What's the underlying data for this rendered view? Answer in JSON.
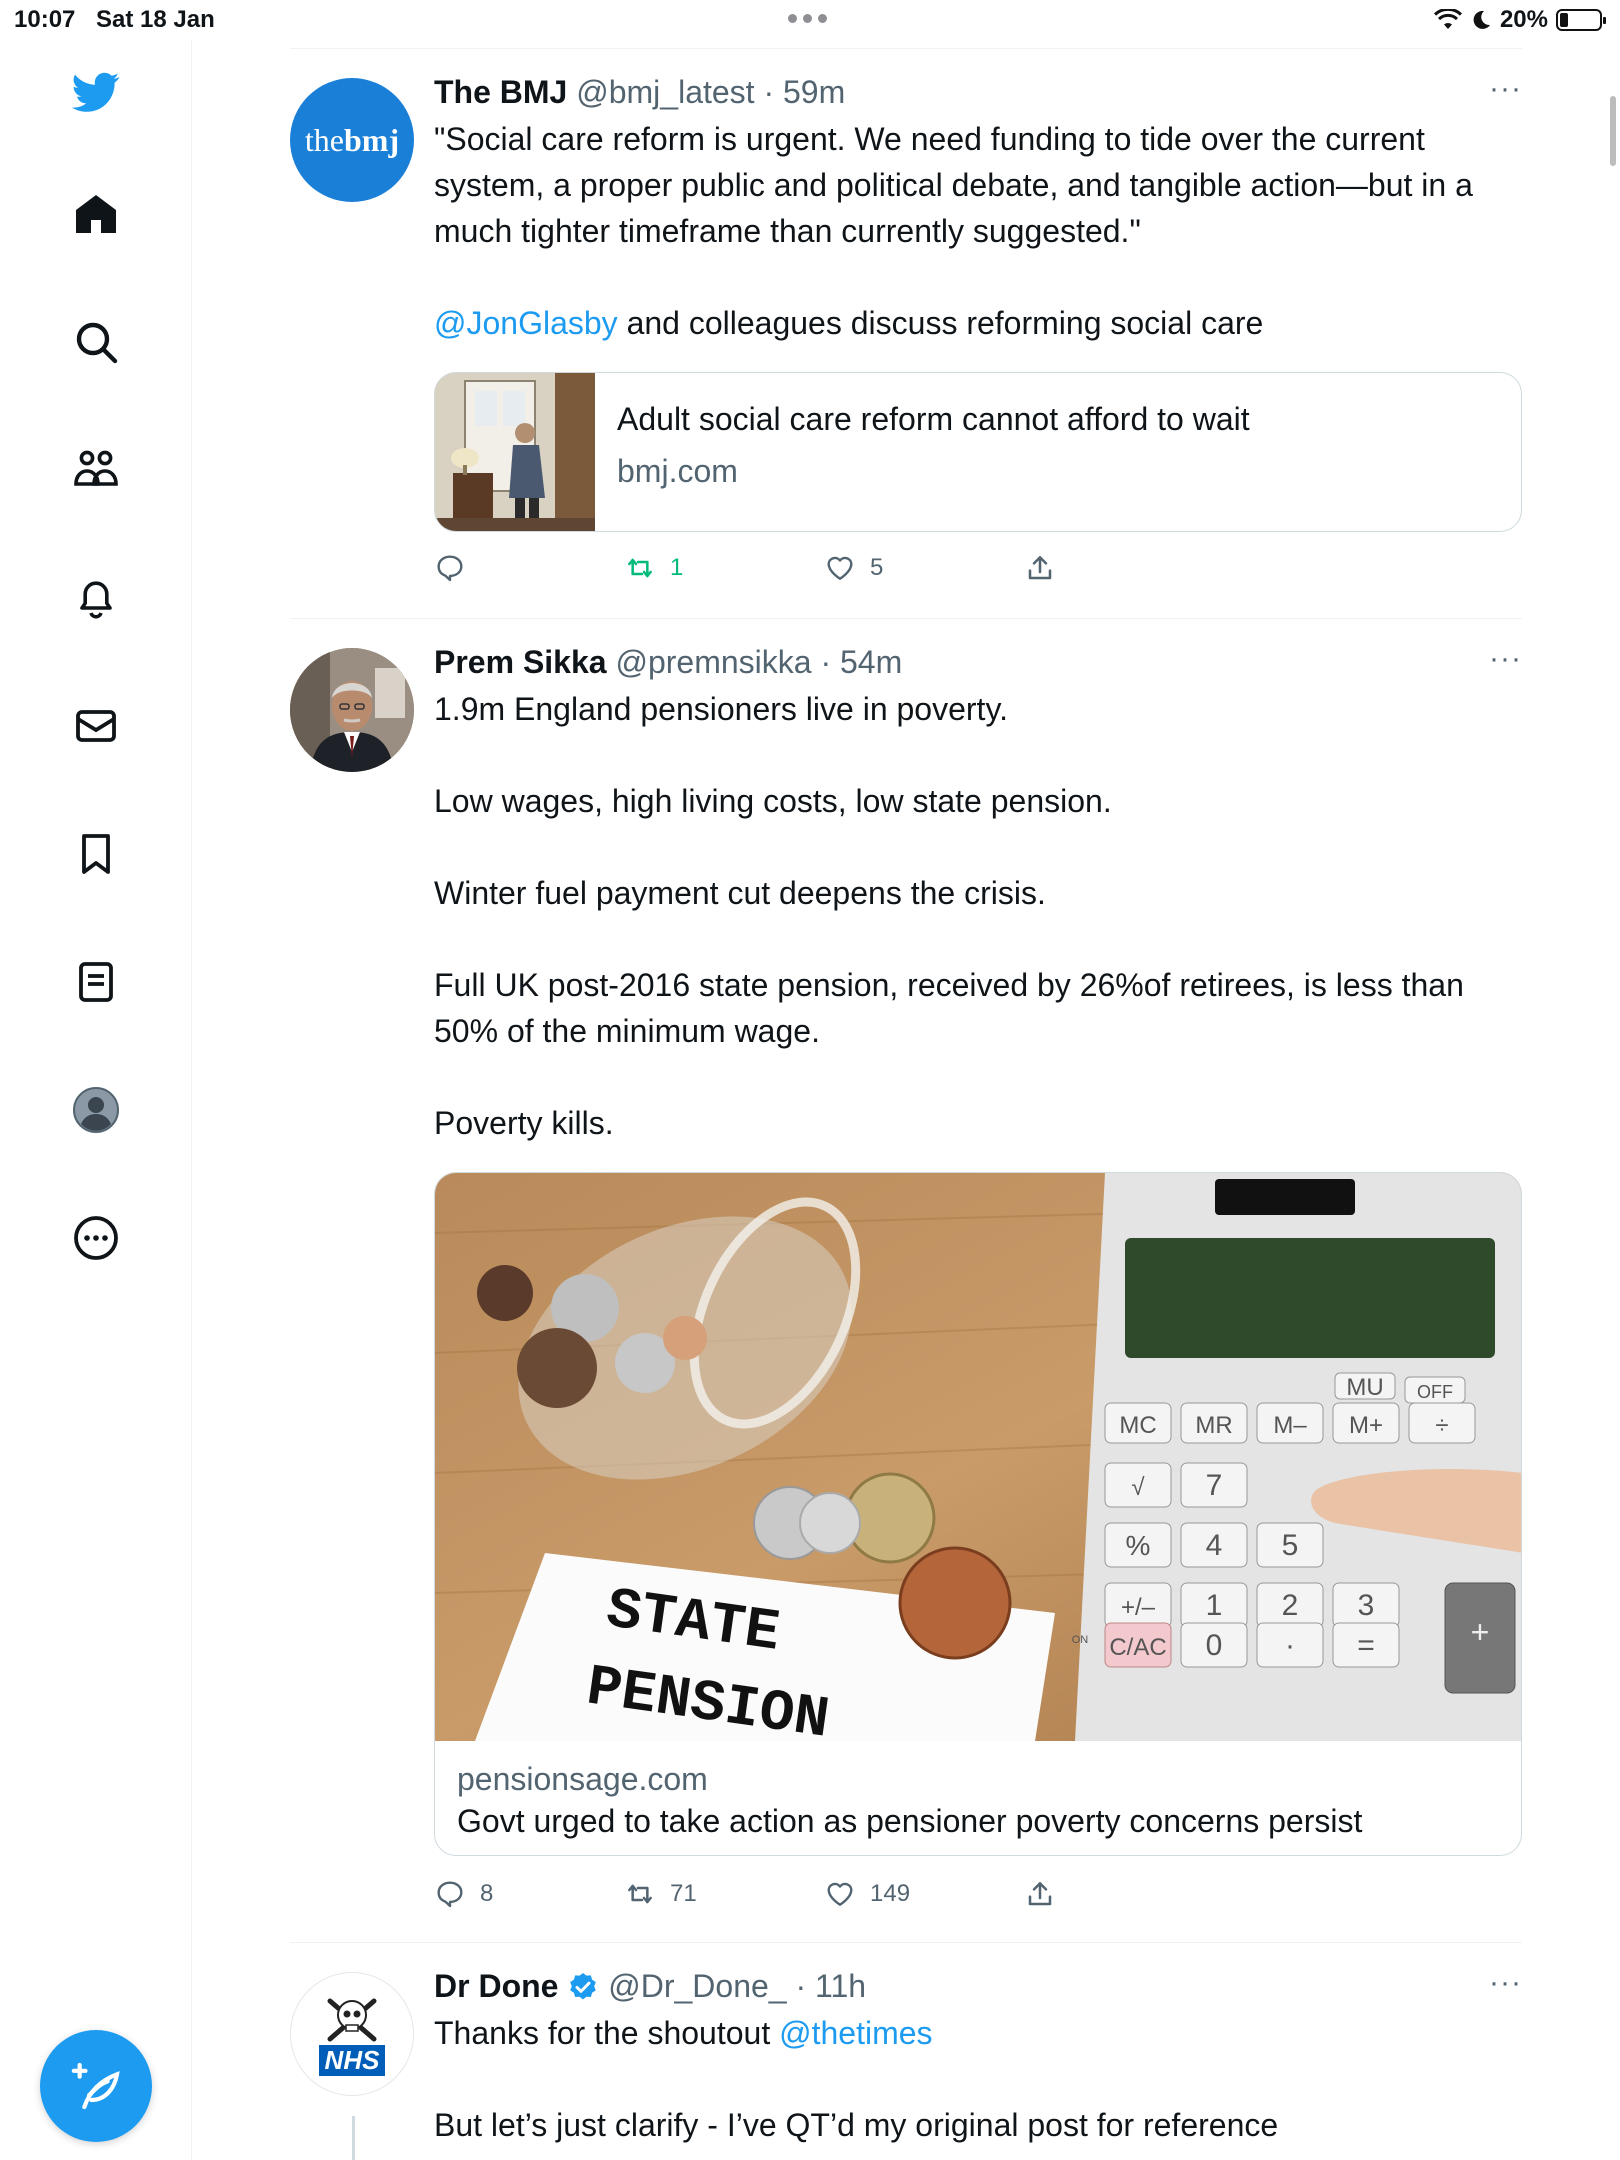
{
  "status_bar": {
    "time": "10:07",
    "date": "Sat 18 Jan",
    "battery": "20%",
    "battery_level": 0.2
  },
  "sidebar": {
    "items": [
      "twitter-logo",
      "home",
      "explore",
      "communities",
      "notifications",
      "messages",
      "bookmarks",
      "lists",
      "profile",
      "more"
    ]
  },
  "colors": {
    "accent": "#1d9bf0",
    "retweet_active": "#00ba7c",
    "text_secondary": "#536471"
  },
  "tweets": [
    {
      "name": "The BMJ",
      "handle": "@bmj_latest",
      "sep": "·",
      "time": "59m",
      "more": "···",
      "avatar_text_a": "the",
      "avatar_text_b": "bmj",
      "text": [
        "\"Social care reform is urgent. We need funding to tide over the current system, a proper public and political debate, and tangible action—but in a much tighter timeframe than currently suggested.\""
      ],
      "mention": "@JonGlasby",
      "text_after_mention": " and colleagues discuss reforming social care",
      "card": {
        "title": "Adult social care reform cannot afford to wait",
        "domain": "bmj.com"
      },
      "stats": {
        "replies": "",
        "retweets": "1",
        "likes": "5"
      }
    },
    {
      "name": "Prem Sikka",
      "handle": "@premnsikka",
      "sep": "·",
      "time": "54m",
      "more": "···",
      "paragraphs": [
        "1.9m England pensioners live in poverty.",
        "Low wages, high living costs, low state pension.",
        "Winter fuel payment cut deepens the crisis.",
        "Full UK post-2016 state pension, received by 26%of retirees, is less than 50% of the minimum wage.",
        "Poverty kills."
      ],
      "card": {
        "domain": "pensionsage.com",
        "title": "Govt urged to take action as pensioner poverty concerns persist",
        "image_text_1": "STATE",
        "image_text_2": "PENSION",
        "calc_keys": [
          "MU",
          "OFF",
          "MC",
          "MR",
          "M–",
          "M+",
          "÷",
          "√",
          "7",
          "%",
          "4",
          "5",
          "+/–",
          "1",
          "2",
          "3",
          "+",
          "ON",
          "C/AC",
          "0",
          "·",
          "="
        ]
      },
      "stats": {
        "replies": "8",
        "retweets": "71",
        "likes": "149"
      }
    },
    {
      "name": "Dr Done",
      "handle": "@Dr_Done_",
      "sep": "·",
      "time": "11h",
      "more": "···",
      "avatar_text": "NHS",
      "text_before_mention": "Thanks for the shoutout ",
      "mention": "@thetimes",
      "text_2": "But let’s just clarify - I’ve QT’d my original post for reference"
    }
  ]
}
